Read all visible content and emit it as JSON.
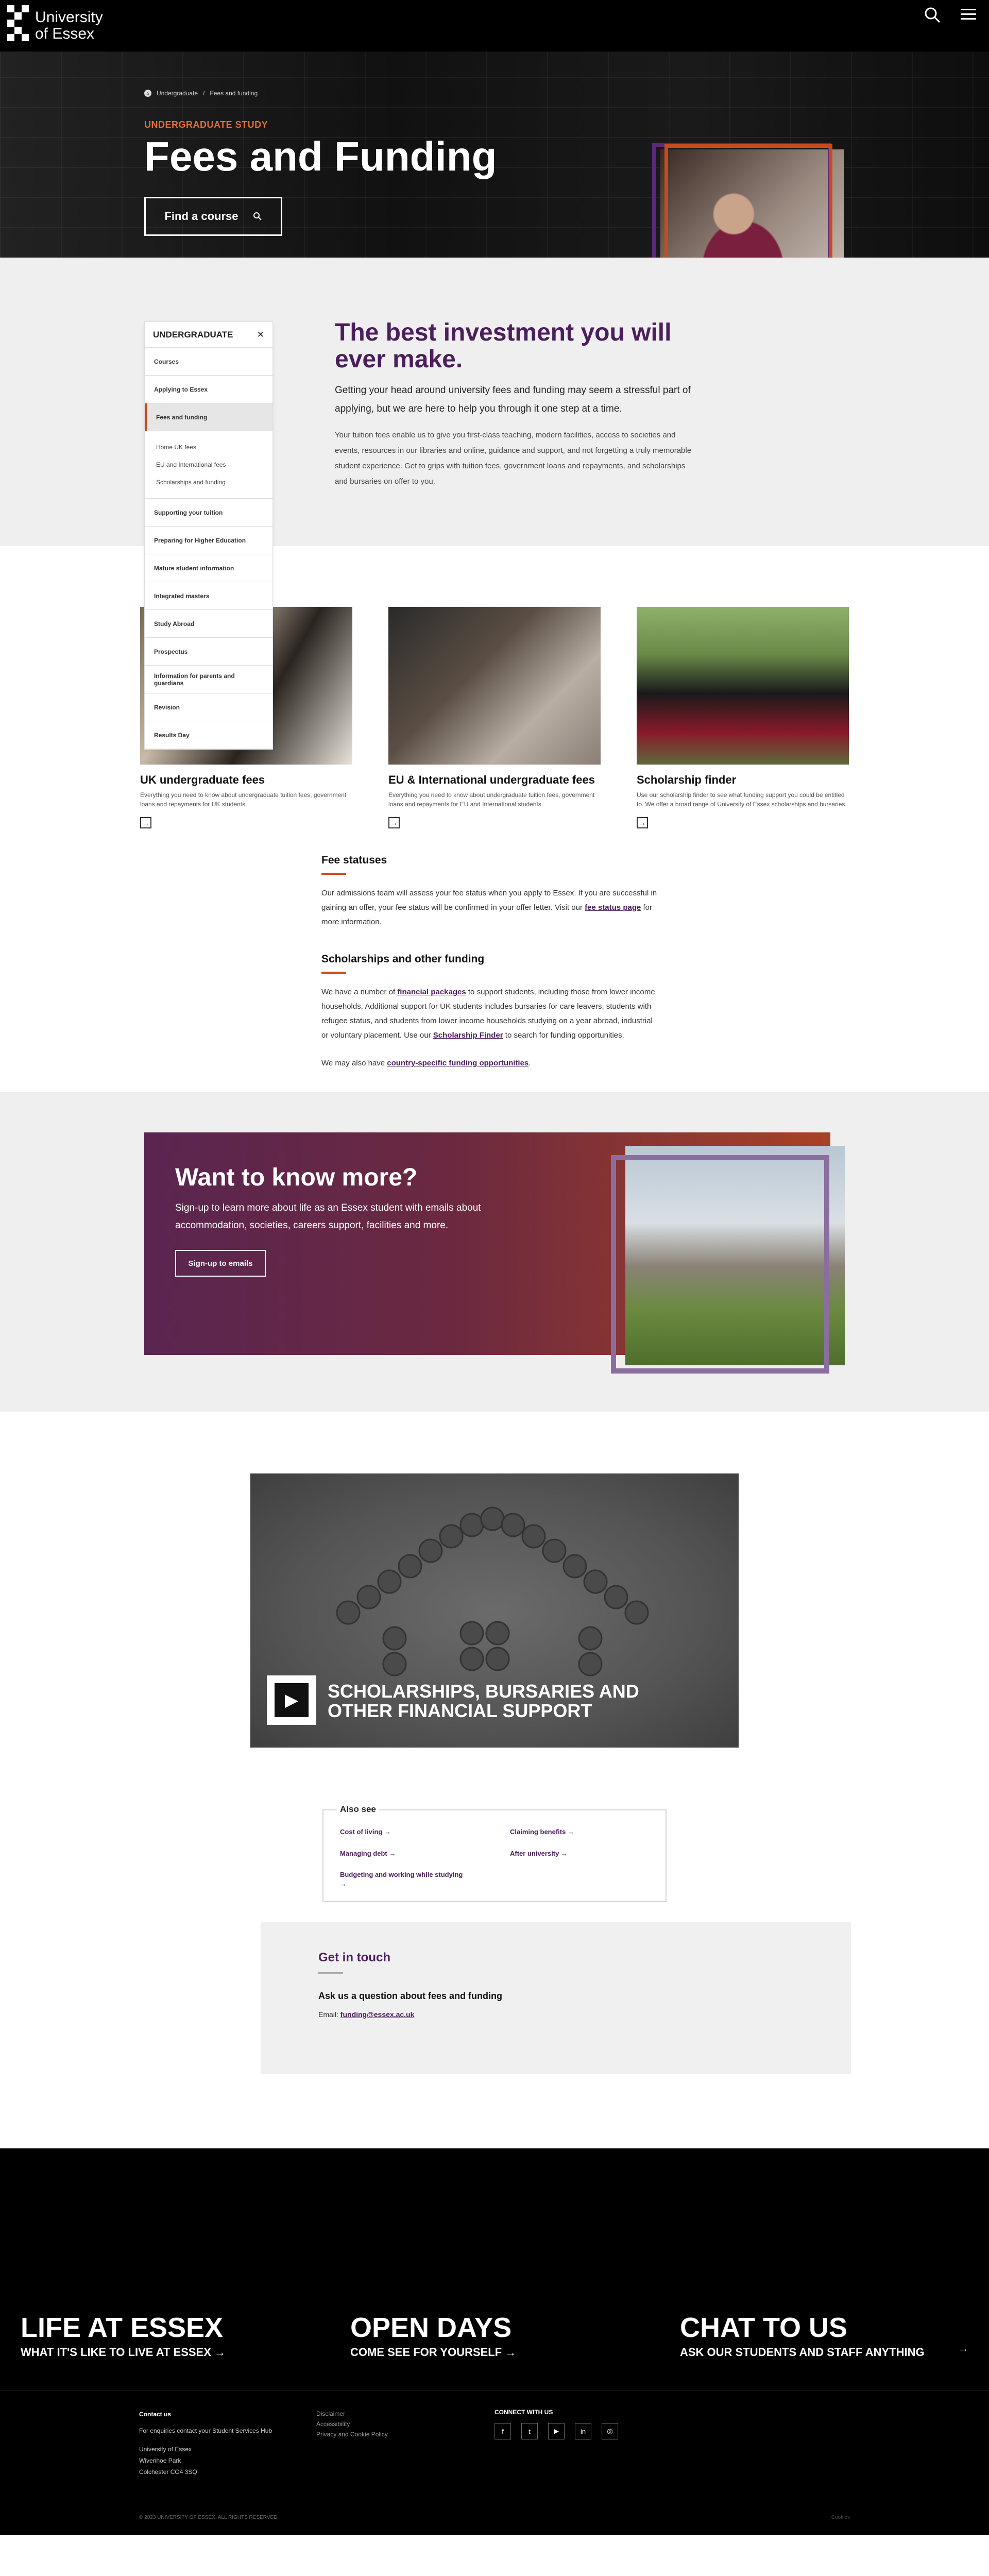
{
  "header": {
    "logo_line1": "University",
    "logo_line2": "of Essex",
    "search_icon": "search-icon",
    "menu_icon": "hamburger-menu-icon"
  },
  "hero": {
    "breadcrumb": [
      "Undergraduate",
      "Fees and funding"
    ],
    "kicker": "UNDERGRADUATE STUDY",
    "title": "Fees and Funding",
    "find_button": "Find a course"
  },
  "sidenav": {
    "title": "UNDERGRADUATE",
    "items_top": [
      "Courses",
      "Applying to Essex"
    ],
    "active": "Fees and funding",
    "subitems": [
      "Home UK fees",
      "EU and International fees",
      "Scholarships and funding"
    ],
    "items_bottom": [
      "Supporting your tuition",
      "Preparing for Higher Education",
      "Mature student information",
      "Integrated masters",
      "Study Abroad",
      "Prospectus",
      "Information for parents and guardians",
      "Revision",
      "Results Day"
    ]
  },
  "intro": {
    "heading": "The best investment you will ever make.",
    "lead": "Getting your head around university fees and funding may seem a stressful part of applying, but we are here to help you through it one step at a time.",
    "body": "Your tuition fees enable us to give you first-class teaching, modern facilities, access to societies and events, resources in our libraries and online, guidance and support, and not forgetting a truly memorable student experience. Get to grips with tuition fees, government loans and repayments, and scholarships and bursaries on offer to you."
  },
  "cards": [
    {
      "title": "UK undergraduate fees",
      "text": "Everything you need to know about undergraduate tuition fees, government loans and repayments for UK students."
    },
    {
      "title": "EU & International undergraduate fees",
      "text": "Everything you need to know about undergraduate tuition fees, government loans and repayments for EU and International students."
    },
    {
      "title": "Scholarship finder",
      "text": "Use our scholarship finder to see what funding support you could be entitled to. We offer a broad range of University of Essex scholarships and bursaries."
    }
  ],
  "fees": {
    "h1": "Fee statuses",
    "p1a": "Our admissions team will assess your fee status when you apply to Essex. If you are successful in gaining an offer, your fee status will be confirmed in your offer letter. Visit our ",
    "p1link": "fee status page",
    "p1b": " for more information.",
    "h2": "Scholarships and other funding",
    "p2a": "We have a number of ",
    "p2link1": "financial packages",
    "p2b": " to support students, including those from lower income households. Additional support for UK students includes bursaries for care leavers, students with refugee status, and students from lower income households studying on a year abroad, industrial or voluntary placement. Use our ",
    "p2link2": "Scholarship Finder",
    "p2c": " to search for funding opportunities.",
    "p3a": "We may also have ",
    "p3link": "country-specific funding opportunities",
    "p3b": "."
  },
  "cta": {
    "title": "Want to know more?",
    "text": "Sign-up to learn more about life as an Essex student with emails about accommodation, societies, careers support, facilities and more.",
    "button": "Sign-up to emails"
  },
  "video": {
    "title": "SCHOLARSHIPS, BURSARIES AND OTHER FINANCIAL SUPPORT"
  },
  "also": {
    "title": "Also see",
    "links": [
      "Cost of living",
      "Claiming benefits",
      "Managing debt",
      "After university",
      "Budgeting and working while studying"
    ]
  },
  "touch": {
    "title": "Get in touch",
    "question": "Ask us a question about fees and funding",
    "email_label": "Email: ",
    "email": "funding@essex.ac.uk"
  },
  "promo": [
    {
      "big": "LIFE AT ESSEX",
      "small": "WHAT IT'S LIKE TO LIVE AT ESSEX"
    },
    {
      "big": "OPEN DAYS",
      "small": "COME SEE FOR YOURSELF"
    },
    {
      "big": "CHAT TO US",
      "small": "ASK OUR STUDENTS AND STAFF ANYTHING"
    }
  ],
  "footer": {
    "contact_title": "Contact us",
    "contact_text": "For enquiries contact your Student Services Hub",
    "address": [
      "University of Essex",
      "Wivenhoe Park",
      "Colchester CO4 3SQ"
    ],
    "links": [
      "Disclaimer",
      "Accessibility",
      "Privacy and Cookie Policy"
    ],
    "connect": "CONNECT WITH US",
    "socials": [
      "f",
      "t",
      "▶",
      "in",
      "◎"
    ],
    "copyright": "© 2023 UNIVERSITY OF ESSEX. ALL RIGHTS RESERVED",
    "right": "Cookies"
  },
  "colors": {
    "brand_purple": "#4b1e5c",
    "accent_orange": "#c94b1b"
  }
}
